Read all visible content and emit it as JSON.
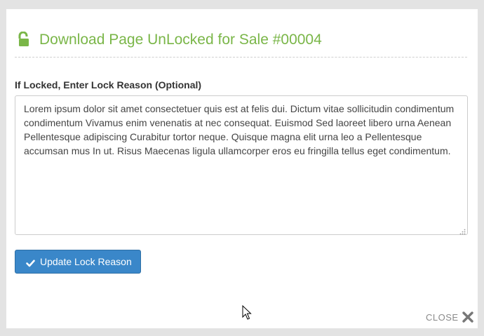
{
  "modal": {
    "title": "Download Page UnLocked for Sale #00004",
    "title_color": "#7ab648",
    "lock_icon": "unlock-icon"
  },
  "form": {
    "label": "If Locked, Enter Lock Reason (Optional)",
    "reason_value": "Lorem ipsum dolor sit amet consectetuer quis est at felis dui. Dictum vitae sollicitudin condimentum condimentum Vivamus enim venenatis at nec consequat. Euismod Sed laoreet libero urna Aenean Pellentesque adipiscing Curabitur tortor neque. Quisque magna elit urna leo a Pellentesque accumsan mus In ut. Risus Maecenas ligula ullamcorper eros eu fringilla tellus eget condimentum.",
    "update_button_label": "Update Lock Reason",
    "button_color": "#3a87c9"
  },
  "footer": {
    "close_label": "CLOSE"
  }
}
